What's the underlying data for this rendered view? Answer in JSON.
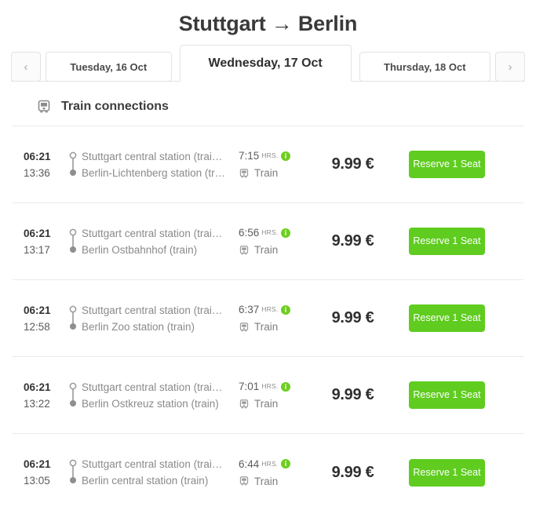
{
  "header": {
    "origin": "Stuttgart",
    "arrow": "→",
    "destination": "Berlin",
    "title": "Stuttgart → Berlin"
  },
  "date_nav": {
    "prev_label": "‹",
    "next_label": "›",
    "prev_icon": "chevron-left-icon",
    "next_icon": "chevron-right-icon",
    "tabs": [
      {
        "label": "Tuesday, 16 Oct",
        "active": false
      },
      {
        "label": "Wednesday, 17 Oct",
        "active": true
      },
      {
        "label": "Thursday, 18 Oct",
        "active": false
      }
    ]
  },
  "section": {
    "icon": "train-icon",
    "title": "Train connections"
  },
  "colors": {
    "accent_green": "#5fcc1f",
    "info_green": "#6ccf1e",
    "text_dark": "#333333",
    "text_muted": "#8a8a8a",
    "border": "#ebebeb"
  },
  "connections": [
    {
      "departure_time": "06:21",
      "arrival_time": "13:36",
      "origin_station": "Stuttgart central station (trai…",
      "destination_station": "Berlin-Lichtenberg station (tr…",
      "duration_value": "7:15",
      "duration_unit": "HRS.",
      "info_icon": "info-icon",
      "mode_icon": "train-icon",
      "mode_label": "Train",
      "price": "9.99 €",
      "action_label": "Reserve 1 Seat"
    },
    {
      "departure_time": "06:21",
      "arrival_time": "13:17",
      "origin_station": "Stuttgart central station (trai…",
      "destination_station": "Berlin Ostbahnhof (train)",
      "duration_value": "6:56",
      "duration_unit": "HRS.",
      "info_icon": "info-icon",
      "mode_icon": "train-icon",
      "mode_label": "Train",
      "price": "9.99 €",
      "action_label": "Reserve 1 Seat"
    },
    {
      "departure_time": "06:21",
      "arrival_time": "12:58",
      "origin_station": "Stuttgart central station (trai…",
      "destination_station": "Berlin Zoo station (train)",
      "duration_value": "6:37",
      "duration_unit": "HRS.",
      "info_icon": "info-icon",
      "mode_icon": "train-icon",
      "mode_label": "Train",
      "price": "9.99 €",
      "action_label": "Reserve 1 Seat"
    },
    {
      "departure_time": "06:21",
      "arrival_time": "13:22",
      "origin_station": "Stuttgart central station (trai…",
      "destination_station": "Berlin Ostkreuz station (train)",
      "duration_value": "7:01",
      "duration_unit": "HRS.",
      "info_icon": "info-icon",
      "mode_icon": "train-icon",
      "mode_label": "Train",
      "price": "9.99 €",
      "action_label": "Reserve 1 Seat"
    },
    {
      "departure_time": "06:21",
      "arrival_time": "13:05",
      "origin_station": "Stuttgart central station (trai…",
      "destination_station": "Berlin central station (train)",
      "duration_value": "6:44",
      "duration_unit": "HRS.",
      "info_icon": "info-icon",
      "mode_icon": "train-icon",
      "mode_label": "Train",
      "price": "9.99 €",
      "action_label": "Reserve 1 Seat"
    }
  ]
}
